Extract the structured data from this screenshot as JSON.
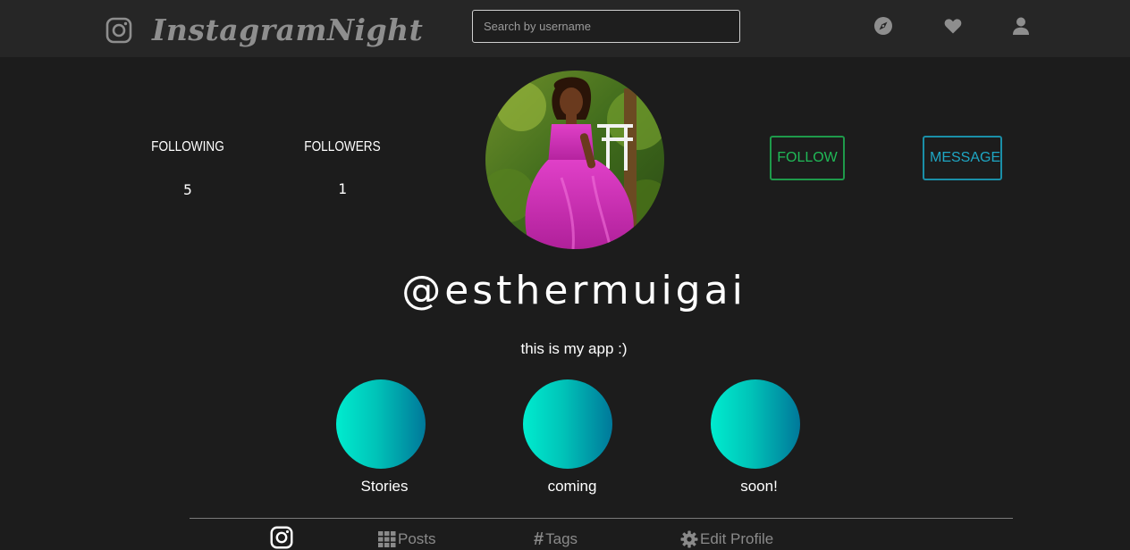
{
  "brand": {
    "name": "InstagramNight",
    "icon": "instagram-icon"
  },
  "search": {
    "placeholder": "Search by username",
    "value": ""
  },
  "nav": {
    "icons": [
      "compass-icon",
      "heart-icon",
      "user-icon"
    ]
  },
  "profile": {
    "following_label": "FOLLOWING",
    "following_count": "5",
    "followers_label": "FOLLOWERS",
    "followers_count": "1",
    "username": "@esthermuigai",
    "bio": "this is my app :)",
    "follow_label": "FOLLOW",
    "message_label": "MESSAGE"
  },
  "stories": [
    "Stories",
    "coming",
    "soon!"
  ],
  "tabs": {
    "home_icon": "instagram-icon",
    "posts": "Posts",
    "tags": "Tags",
    "edit_profile": "Edit Profile"
  },
  "colors": {
    "background": "#1c1c1c",
    "navbar": "#262626",
    "follow": "#20b957",
    "message": "#1ea6c3",
    "story_gradient_start": "#00eccf",
    "story_gradient_end": "#00789a"
  }
}
